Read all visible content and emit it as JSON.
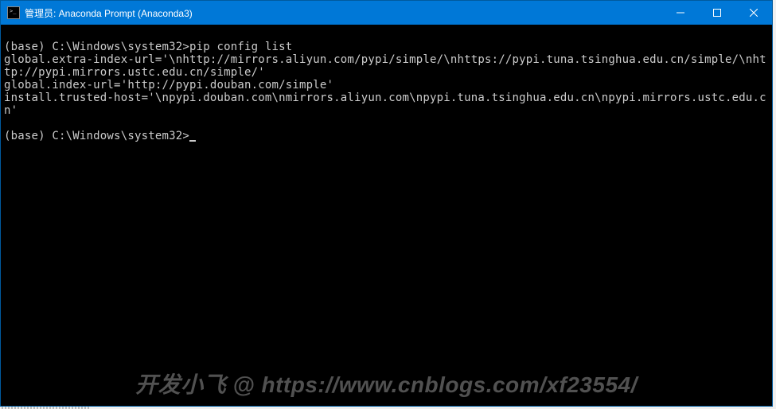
{
  "titlebar": {
    "text": "管理员: Anaconda Prompt (Anaconda3)"
  },
  "terminal": {
    "line1_prompt": "(base) C:\\Windows\\system32>",
    "line1_cmd": "pip config list",
    "output1": "global.extra-index-url='\\nhttp://mirrors.aliyun.com/pypi/simple/\\nhttps://pypi.tuna.tsinghua.edu.cn/simple/\\nhttp://pypi.mirrors.ustc.edu.cn/simple/'",
    "output2": "global.index-url='http://pypi.douban.com/simple'",
    "output3": "install.trusted-host='\\npypi.douban.com\\nmirrors.aliyun.com\\npypi.tuna.tsinghua.edu.cn\\npypi.mirrors.ustc.edu.cn'",
    "line2_prompt": "(base) C:\\Windows\\system32>"
  },
  "watermark": {
    "text": "开发小飞 @ https://www.cnblogs.com/xf23554/"
  }
}
